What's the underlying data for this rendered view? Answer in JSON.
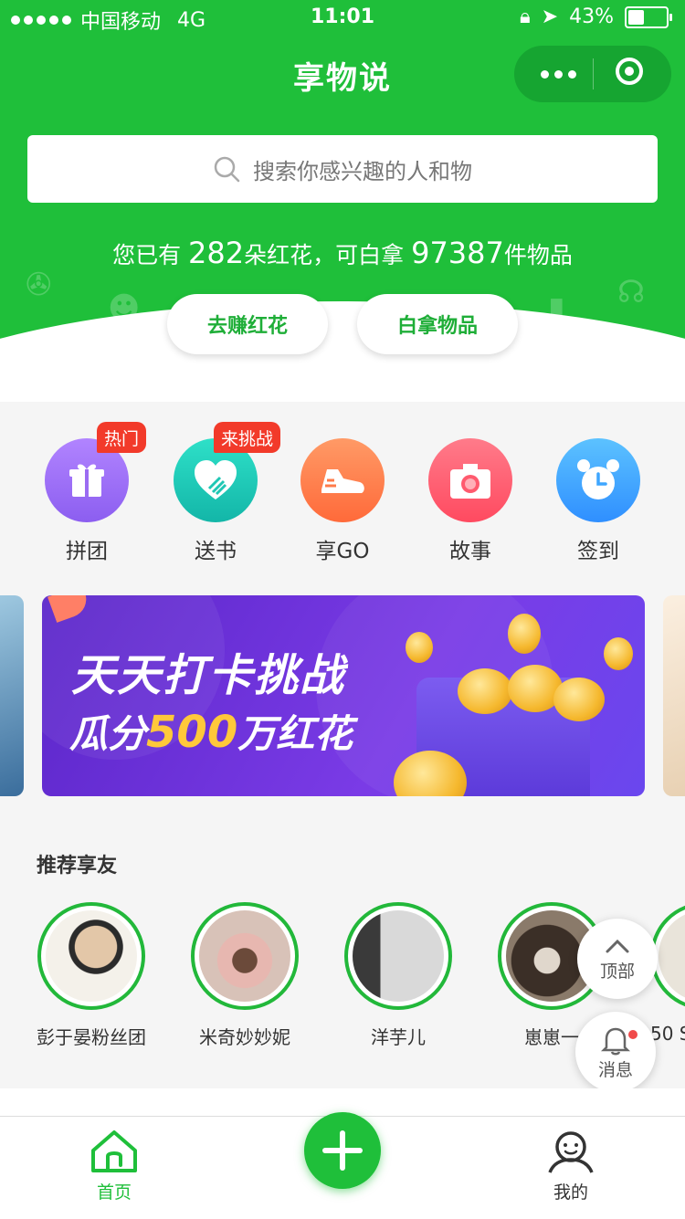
{
  "status_bar": {
    "carrier": "中国移动",
    "network": "4G",
    "time": "11:01",
    "battery": "43%",
    "battery_level": 0.43
  },
  "header": {
    "title": "享物说"
  },
  "search": {
    "placeholder": "搜索你感兴趣的人和物"
  },
  "stats": {
    "prefix": "您已有 ",
    "flowers": "282",
    "flowers_suffix": "朵红花，可白拿 ",
    "items": "97387",
    "items_suffix": "件物品"
  },
  "actions": {
    "earn": "去赚红花",
    "take": "白拿物品"
  },
  "categories": [
    {
      "label": "拼团",
      "badge": "热门",
      "icon": "gift-icon",
      "color": "#9b6cf2"
    },
    {
      "label": "送书",
      "badge": "来挑战",
      "icon": "heart-hand-icon",
      "color": "#1fc7b4"
    },
    {
      "label": "享GO",
      "badge": "",
      "icon": "sneaker-icon",
      "color": "#ff7b4a"
    },
    {
      "label": "故事",
      "badge": "",
      "icon": "camera-icon",
      "color": "#ff5a6e"
    },
    {
      "label": "签到",
      "badge": "",
      "icon": "alarm-clock-icon",
      "color": "#3ea6ff"
    }
  ],
  "banner": {
    "line1": "天天打卡挑战",
    "line2_a": "瓜分",
    "line2_num": "500",
    "line2_b": "万红花"
  },
  "friends": {
    "title": "推荐享友",
    "items": [
      {
        "name": "彭于晏粉丝团",
        "color": "#d9d3c8"
      },
      {
        "name": "米奇妙妙妮",
        "color": "#c9a79a"
      },
      {
        "name": "洋芋儿",
        "color": "#9a9a9a"
      },
      {
        "name": "崽崽一",
        "color": "#6b5a4a"
      },
      {
        "name": "50 S",
        "color": "#e9e4da"
      }
    ]
  },
  "float": {
    "top": "顶部",
    "message": "消息"
  },
  "tabbar": {
    "home": "首页",
    "mine": "我的",
    "active_color": "#1fbf3a"
  }
}
